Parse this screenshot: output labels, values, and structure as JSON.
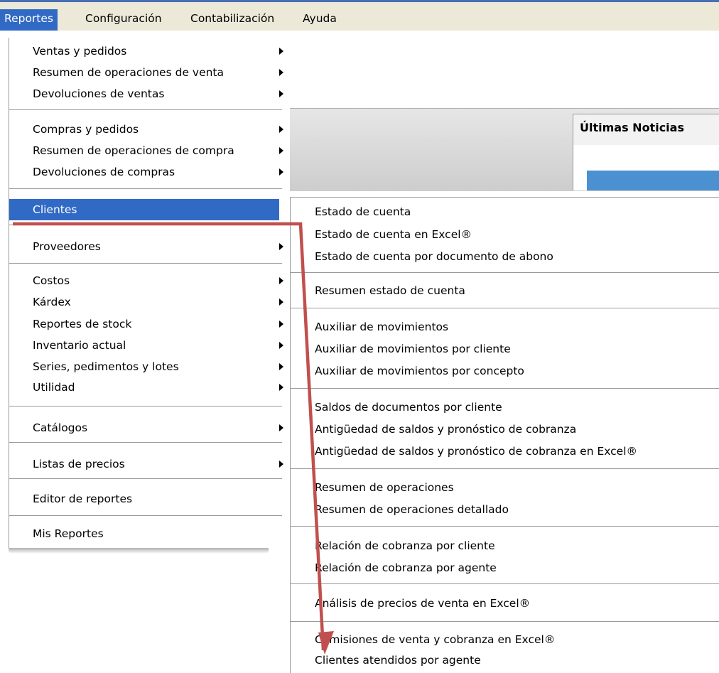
{
  "menubar": {
    "items": [
      {
        "label": "Reportes",
        "active": true
      },
      {
        "label": "Configuración",
        "active": false
      },
      {
        "label": "Contabilización",
        "active": false
      },
      {
        "label": "Ayuda",
        "active": false
      }
    ]
  },
  "background": {
    "news_title": "Últimas Noticias"
  },
  "reportes_menu": {
    "items": [
      {
        "label": "Ventas y pedidos",
        "has_submenu": true
      },
      {
        "label": "Resumen de operaciones de venta",
        "has_submenu": true
      },
      {
        "label": "Devoluciones de ventas",
        "has_submenu": true
      },
      {
        "label": "Compras y pedidos",
        "has_submenu": true
      },
      {
        "label": "Resumen de operaciones de compra",
        "has_submenu": true
      },
      {
        "label": "Devoluciones de compras",
        "has_submenu": true
      },
      {
        "label": "Clientes",
        "has_submenu": true,
        "highlighted": true
      },
      {
        "label": "Proveedores",
        "has_submenu": true
      },
      {
        "label": "Costos",
        "has_submenu": true
      },
      {
        "label": "Kárdex",
        "has_submenu": true
      },
      {
        "label": "Reportes de stock",
        "has_submenu": true
      },
      {
        "label": "Inventario actual",
        "has_submenu": true
      },
      {
        "label": "Series, pedimentos y lotes",
        "has_submenu": true
      },
      {
        "label": "Utilidad",
        "has_submenu": true
      },
      {
        "label": "Catálogos",
        "has_submenu": true
      },
      {
        "label": "Listas de precios",
        "has_submenu": true
      },
      {
        "label": "Editor de reportes",
        "has_submenu": false
      },
      {
        "label": "Mis Reportes",
        "has_submenu": false
      }
    ]
  },
  "clientes_submenu": {
    "items": [
      {
        "label": "Estado de cuenta"
      },
      {
        "label": "Estado de cuenta en Excel®"
      },
      {
        "label": "Estado de cuenta por documento de abono"
      },
      {
        "label": "Resumen estado de cuenta"
      },
      {
        "label": "Auxiliar de movimientos"
      },
      {
        "label": "Auxiliar de movimientos por cliente"
      },
      {
        "label": "Auxiliar de movimientos por concepto"
      },
      {
        "label": "Saldos de documentos por cliente"
      },
      {
        "label": "Antigüedad de saldos y pronóstico de cobranza"
      },
      {
        "label": "Antigüedad de saldos y pronóstico de cobranza en Excel®"
      },
      {
        "label": "Resumen de operaciones"
      },
      {
        "label": "Resumen de operaciones detallado"
      },
      {
        "label": "Relación de cobranza por cliente"
      },
      {
        "label": "Relación de cobranza por agente"
      },
      {
        "label": "Análisis de precios de venta en Excel®"
      },
      {
        "label": "Comisiones de venta y cobranza en Excel®"
      },
      {
        "label": "Clientes atendidos por agente"
      }
    ]
  },
  "colors": {
    "highlight": "#316ac5",
    "menubar_bg": "#ece9d8",
    "annotation_arrow": "#c0504d",
    "news_accent": "#4b90d0"
  }
}
